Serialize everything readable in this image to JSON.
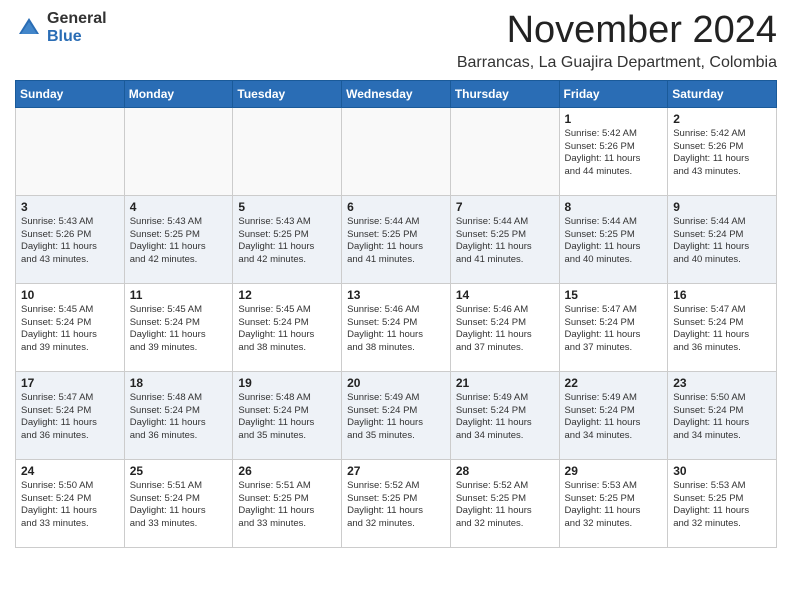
{
  "header": {
    "logo_general": "General",
    "logo_blue": "Blue",
    "month_title": "November 2024",
    "subtitle": "Barrancas, La Guajira Department, Colombia"
  },
  "calendar": {
    "days_of_week": [
      "Sunday",
      "Monday",
      "Tuesday",
      "Wednesday",
      "Thursday",
      "Friday",
      "Saturday"
    ],
    "weeks": [
      [
        {
          "day": "",
          "info": ""
        },
        {
          "day": "",
          "info": ""
        },
        {
          "day": "",
          "info": ""
        },
        {
          "day": "",
          "info": ""
        },
        {
          "day": "",
          "info": ""
        },
        {
          "day": "1",
          "info": "Sunrise: 5:42 AM\nSunset: 5:26 PM\nDaylight: 11 hours\nand 44 minutes."
        },
        {
          "day": "2",
          "info": "Sunrise: 5:42 AM\nSunset: 5:26 PM\nDaylight: 11 hours\nand 43 minutes."
        }
      ],
      [
        {
          "day": "3",
          "info": "Sunrise: 5:43 AM\nSunset: 5:26 PM\nDaylight: 11 hours\nand 43 minutes."
        },
        {
          "day": "4",
          "info": "Sunrise: 5:43 AM\nSunset: 5:25 PM\nDaylight: 11 hours\nand 42 minutes."
        },
        {
          "day": "5",
          "info": "Sunrise: 5:43 AM\nSunset: 5:25 PM\nDaylight: 11 hours\nand 42 minutes."
        },
        {
          "day": "6",
          "info": "Sunrise: 5:44 AM\nSunset: 5:25 PM\nDaylight: 11 hours\nand 41 minutes."
        },
        {
          "day": "7",
          "info": "Sunrise: 5:44 AM\nSunset: 5:25 PM\nDaylight: 11 hours\nand 41 minutes."
        },
        {
          "day": "8",
          "info": "Sunrise: 5:44 AM\nSunset: 5:25 PM\nDaylight: 11 hours\nand 40 minutes."
        },
        {
          "day": "9",
          "info": "Sunrise: 5:44 AM\nSunset: 5:24 PM\nDaylight: 11 hours\nand 40 minutes."
        }
      ],
      [
        {
          "day": "10",
          "info": "Sunrise: 5:45 AM\nSunset: 5:24 PM\nDaylight: 11 hours\nand 39 minutes."
        },
        {
          "day": "11",
          "info": "Sunrise: 5:45 AM\nSunset: 5:24 PM\nDaylight: 11 hours\nand 39 minutes."
        },
        {
          "day": "12",
          "info": "Sunrise: 5:45 AM\nSunset: 5:24 PM\nDaylight: 11 hours\nand 38 minutes."
        },
        {
          "day": "13",
          "info": "Sunrise: 5:46 AM\nSunset: 5:24 PM\nDaylight: 11 hours\nand 38 minutes."
        },
        {
          "day": "14",
          "info": "Sunrise: 5:46 AM\nSunset: 5:24 PM\nDaylight: 11 hours\nand 37 minutes."
        },
        {
          "day": "15",
          "info": "Sunrise: 5:47 AM\nSunset: 5:24 PM\nDaylight: 11 hours\nand 37 minutes."
        },
        {
          "day": "16",
          "info": "Sunrise: 5:47 AM\nSunset: 5:24 PM\nDaylight: 11 hours\nand 36 minutes."
        }
      ],
      [
        {
          "day": "17",
          "info": "Sunrise: 5:47 AM\nSunset: 5:24 PM\nDaylight: 11 hours\nand 36 minutes."
        },
        {
          "day": "18",
          "info": "Sunrise: 5:48 AM\nSunset: 5:24 PM\nDaylight: 11 hours\nand 36 minutes."
        },
        {
          "day": "19",
          "info": "Sunrise: 5:48 AM\nSunset: 5:24 PM\nDaylight: 11 hours\nand 35 minutes."
        },
        {
          "day": "20",
          "info": "Sunrise: 5:49 AM\nSunset: 5:24 PM\nDaylight: 11 hours\nand 35 minutes."
        },
        {
          "day": "21",
          "info": "Sunrise: 5:49 AM\nSunset: 5:24 PM\nDaylight: 11 hours\nand 34 minutes."
        },
        {
          "day": "22",
          "info": "Sunrise: 5:49 AM\nSunset: 5:24 PM\nDaylight: 11 hours\nand 34 minutes."
        },
        {
          "day": "23",
          "info": "Sunrise: 5:50 AM\nSunset: 5:24 PM\nDaylight: 11 hours\nand 34 minutes."
        }
      ],
      [
        {
          "day": "24",
          "info": "Sunrise: 5:50 AM\nSunset: 5:24 PM\nDaylight: 11 hours\nand 33 minutes."
        },
        {
          "day": "25",
          "info": "Sunrise: 5:51 AM\nSunset: 5:24 PM\nDaylight: 11 hours\nand 33 minutes."
        },
        {
          "day": "26",
          "info": "Sunrise: 5:51 AM\nSunset: 5:25 PM\nDaylight: 11 hours\nand 33 minutes."
        },
        {
          "day": "27",
          "info": "Sunrise: 5:52 AM\nSunset: 5:25 PM\nDaylight: 11 hours\nand 32 minutes."
        },
        {
          "day": "28",
          "info": "Sunrise: 5:52 AM\nSunset: 5:25 PM\nDaylight: 11 hours\nand 32 minutes."
        },
        {
          "day": "29",
          "info": "Sunrise: 5:53 AM\nSunset: 5:25 PM\nDaylight: 11 hours\nand 32 minutes."
        },
        {
          "day": "30",
          "info": "Sunrise: 5:53 AM\nSunset: 5:25 PM\nDaylight: 11 hours\nand 32 minutes."
        }
      ]
    ]
  }
}
